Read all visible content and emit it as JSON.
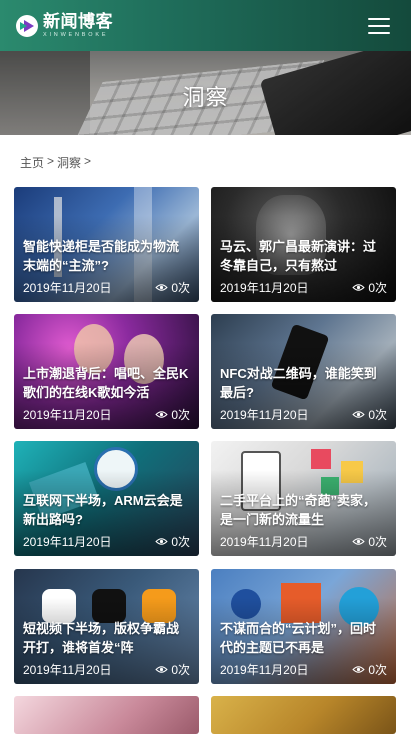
{
  "header": {
    "logo_title": "新闻博客",
    "logo_subtitle": "XINWENBOKE",
    "icons": {
      "logo": "play-logo-icon",
      "menu": "hamburger-menu-icon"
    },
    "colors": {
      "header_start": "#2b8a6e",
      "header_end": "#144a3c"
    }
  },
  "banner": {
    "title": "洞察"
  },
  "breadcrumb": {
    "home": "主页",
    "separator": ">",
    "current": "洞察",
    "trailing": ">"
  },
  "articles": [
    {
      "title": "智能快递柜是否能成为物流末端的“主流”?",
      "date": "2019年11月20日",
      "views": "0次"
    },
    {
      "title": "马云、郭广昌最新演讲：过冬靠自己，只有熬过",
      "date": "2019年11月20日",
      "views": "0次"
    },
    {
      "title": "上市潮退背后：唱吧、全民K歌们的在线K歌如今活",
      "date": "2019年11月20日",
      "views": "0次"
    },
    {
      "title": "NFC对战二维码，谁能笑到最后?",
      "date": "2019年11月20日",
      "views": "0次"
    },
    {
      "title": "互联网下半场，ARM云会是新出路吗?",
      "date": "2019年11月20日",
      "views": "0次"
    },
    {
      "title": "二手平台上的“奇葩”卖家，是一门新的流量生",
      "date": "2019年11月20日",
      "views": "0次"
    },
    {
      "title": "短视频下半场，版权争霸战开打，谁将首发“阵",
      "date": "2019年11月20日",
      "views": "0次"
    },
    {
      "title": "不谋而合的“云计划”，回时代的主题已不再是",
      "date": "2019年11月20日",
      "views": "0次"
    },
    {
      "title": "",
      "date": "",
      "views": ""
    },
    {
      "title": "",
      "date": "",
      "views": ""
    }
  ]
}
